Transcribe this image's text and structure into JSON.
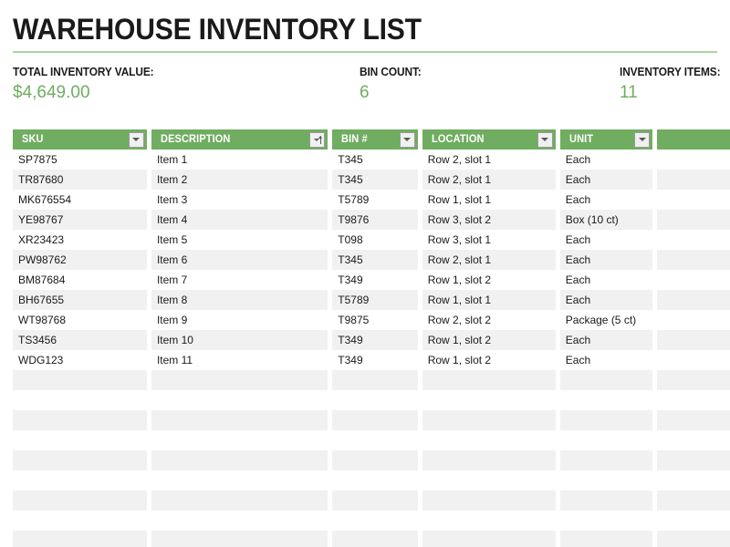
{
  "document": {
    "title": "WAREHOUSE INVENTORY LIST"
  },
  "summary": [
    {
      "label": "TOTAL INVENTORY VALUE:",
      "value": "$4,649.00"
    },
    {
      "label": "BIN COUNT:",
      "value": "6"
    },
    {
      "label": "INVENTORY ITEMS:",
      "value": "11"
    }
  ],
  "theme": {
    "header_green": "#70ad61",
    "rule_green": "#a9d6a0",
    "value_green": "#70ad61",
    "band_gray": "#f1f1f1",
    "text_dark": "#1a1a1a"
  },
  "table": {
    "columns": [
      {
        "label": "SKU",
        "filter_icon": "filter-dropdown-icon",
        "sorted": false
      },
      {
        "label": "DESCRIPTION",
        "filter_icon": "sort-ascending-filter-icon",
        "sorted": true
      },
      {
        "label": "BIN #",
        "filter_icon": "filter-dropdown-icon",
        "sorted": false
      },
      {
        "label": "LOCATION",
        "filter_icon": "filter-dropdown-icon",
        "sorted": false
      },
      {
        "label": "UNIT",
        "filter_icon": "filter-dropdown-icon",
        "sorted": false
      },
      {
        "label": "",
        "filter_icon": "filter-dropdown-icon",
        "sorted": false
      }
    ],
    "rows": [
      {
        "sku": "SP7875",
        "description": "Item 1",
        "bin": "T345",
        "location": "Row 2, slot 1",
        "unit": "Each"
      },
      {
        "sku": "TR87680",
        "description": "Item 2",
        "bin": "T345",
        "location": "Row 2, slot 1",
        "unit": "Each"
      },
      {
        "sku": "MK676554",
        "description": "Item 3",
        "bin": "T5789",
        "location": "Row 1, slot 1",
        "unit": "Each"
      },
      {
        "sku": "YE98767",
        "description": "Item 4",
        "bin": "T9876",
        "location": "Row 3, slot 2",
        "unit": "Box (10 ct)"
      },
      {
        "sku": "XR23423",
        "description": "Item 5",
        "bin": "T098",
        "location": "Row 3, slot 1",
        "unit": "Each"
      },
      {
        "sku": "PW98762",
        "description": "Item 6",
        "bin": "T345",
        "location": "Row 2, slot 1",
        "unit": "Each"
      },
      {
        "sku": "BM87684",
        "description": "Item 7",
        "bin": "T349",
        "location": "Row 1, slot 2",
        "unit": "Each"
      },
      {
        "sku": "BH67655",
        "description": "Item 8",
        "bin": "T5789",
        "location": "Row 1, slot 1",
        "unit": "Each"
      },
      {
        "sku": "WT98768",
        "description": "Item 9",
        "bin": "T9875",
        "location": "Row 2, slot 2",
        "unit": "Package (5 ct)"
      },
      {
        "sku": "TS3456",
        "description": "Item 10",
        "bin": "T349",
        "location": "Row 1, slot 2",
        "unit": "Each"
      },
      {
        "sku": "WDG123",
        "description": "Item 11",
        "bin": "T349",
        "location": "Row 1, slot 2",
        "unit": "Each"
      }
    ],
    "empty_row_count": 9
  }
}
